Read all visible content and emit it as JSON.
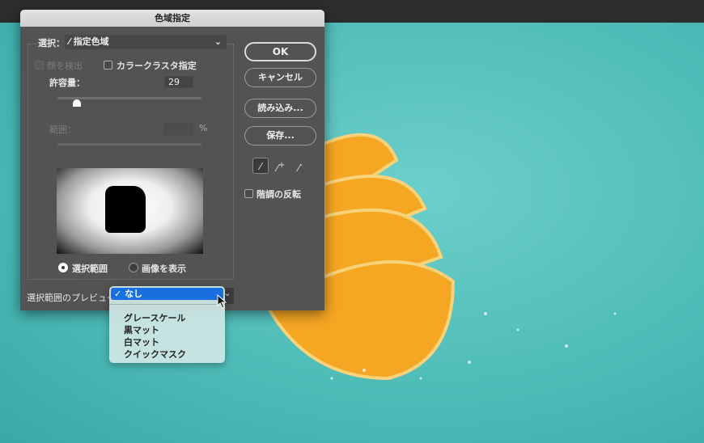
{
  "dialog": {
    "title": "色域指定",
    "select_label": "選択：",
    "select_value": "指定色域",
    "detect_faces": "顔を検出",
    "localized_clusters": "カラークラスタ指定",
    "fuzziness_label": "許容量：",
    "fuzziness_value": "29",
    "fuzziness_fraction": 0.14,
    "range_label": "範囲：",
    "range_value": "",
    "range_unit": "%",
    "radio_selection": "選択範囲",
    "radio_image": "画像を表示",
    "radio_selected": "選択範囲",
    "preview_label": "選択範囲のプレビュー",
    "buttons": {
      "ok": "OK",
      "cancel": "キャンセル",
      "load": "読み込み...",
      "save": "保存..."
    },
    "invert": "階調の反転",
    "eyedroppers": [
      "eyedropper-icon",
      "eyedropper-plus-icon",
      "eyedropper-minus-icon"
    ]
  },
  "preview_menu": {
    "selected": "なし",
    "items": [
      "なし",
      "グレースケール",
      "黒マット",
      "白マット",
      "クイックマスク"
    ]
  },
  "colors": {
    "background": "#52bfbb",
    "dialog": "#535353",
    "highlight": "#1a6fe0",
    "orange": "#f7a21b"
  }
}
